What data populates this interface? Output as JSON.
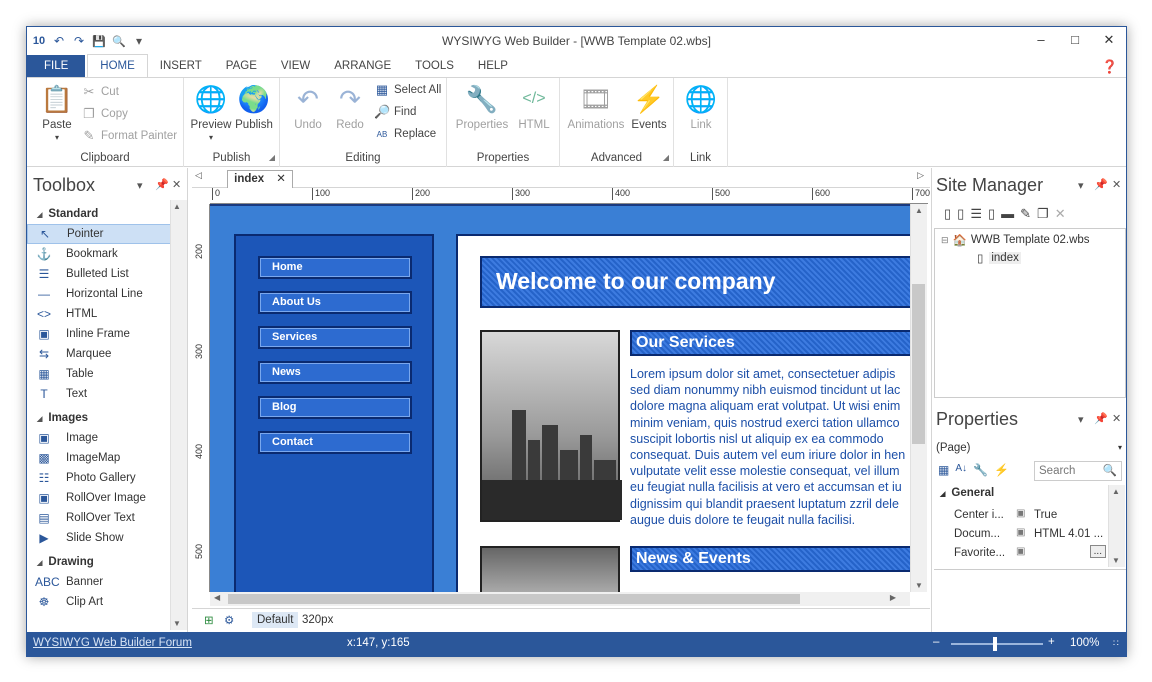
{
  "window": {
    "title": "WYSIWYG Web Builder - [WWB Template 02.wbs]",
    "app_icon": "10"
  },
  "qat": {
    "undo": "↶",
    "redo": "↷",
    "save": "💾",
    "preview": "🔍",
    "dropdown": "▾"
  },
  "controls": {
    "minimize": "–",
    "maximize": "□",
    "close": "✕"
  },
  "tabs": [
    "FILE",
    "HOME",
    "INSERT",
    "PAGE",
    "VIEW",
    "ARRANGE",
    "TOOLS",
    "HELP"
  ],
  "ribbon": {
    "clipboard": {
      "label": "Clipboard",
      "paste": "Paste",
      "cut": "Cut",
      "copy": "Copy",
      "format_painter": "Format Painter"
    },
    "publish": {
      "label": "Publish",
      "preview": "Preview",
      "publish": "Publish"
    },
    "editing": {
      "label": "Editing",
      "undo": "Undo",
      "redo": "Redo",
      "select_all": "Select All",
      "find": "Find",
      "replace": "Replace"
    },
    "properties": {
      "label": "Properties",
      "properties": "Properties",
      "html": "HTML"
    },
    "advanced": {
      "label": "Advanced",
      "animations": "Animations",
      "events": "Events"
    },
    "link": {
      "label": "Link",
      "link": "Link"
    }
  },
  "toolbox": {
    "title": "Toolbox",
    "categories": [
      {
        "name": "Standard",
        "items": [
          "Pointer",
          "Bookmark",
          "Bulleted List",
          "Horizontal Line",
          "HTML",
          "Inline Frame",
          "Marquee",
          "Table",
          "Text"
        ]
      },
      {
        "name": "Images",
        "items": [
          "Image",
          "ImageMap",
          "Photo Gallery",
          "RollOver Image",
          "RollOver Text",
          "Slide Show"
        ]
      },
      {
        "name": "Drawing",
        "items": [
          "Banner",
          "Clip Art"
        ]
      }
    ],
    "icons": [
      "↖",
      "⚓",
      "☰",
      "—",
      "<>",
      "▣",
      "⇆",
      "▦",
      "T",
      "▣",
      "▩",
      "☷",
      "▣",
      "▤",
      "▶",
      "ABC",
      "☸"
    ]
  },
  "document": {
    "tab": "index",
    "ruler_h": [
      "0",
      "100",
      "200",
      "300",
      "400",
      "500",
      "600",
      "700"
    ],
    "ruler_v": [
      "200",
      "300",
      "400",
      "500"
    ],
    "default_label": "Default",
    "width_label": "320px"
  },
  "page": {
    "nav": [
      "Home",
      "About Us",
      "Services",
      "News",
      "Blog",
      "Contact"
    ],
    "hero": "Welcome to our company",
    "services_title": "Our Services",
    "lorem": [
      "Lorem ipsum dolor sit amet, consectetuer adipis",
      "sed diam nonummy nibh euismod tincidunt ut lac",
      "dolore magna aliquam erat volutpat. Ut wisi enim",
      "minim veniam, quis nostrud exerci tation ullamco",
      "suscipit lobortis nisl ut aliquip ex ea commodo",
      "consequat. Duis autem vel eum iriure dolor in hen",
      "vulputate velit esse molestie consequat, vel illum",
      "eu feugiat nulla facilisis at vero et accumsan et iu",
      "dignissim qui blandit praesent luptatum zzril dele",
      "augue duis dolore te feugait nulla facilisi."
    ],
    "news_title": "News & Events"
  },
  "site_manager": {
    "title": "Site Manager",
    "root": "WWB Template 02.wbs",
    "page": "index"
  },
  "properties": {
    "title": "Properties",
    "selector": "(Page)",
    "search_placeholder": "Search",
    "group": "General",
    "rows": [
      {
        "name": "Center i...",
        "value": "True"
      },
      {
        "name": "Docum...",
        "value": "HTML 4.01 ..."
      },
      {
        "name": "Favorite...",
        "value": ""
      }
    ]
  },
  "status": {
    "forum": "WYSIWYG Web Builder Forum",
    "coords": "x:147, y:165",
    "zoom": "100%"
  }
}
